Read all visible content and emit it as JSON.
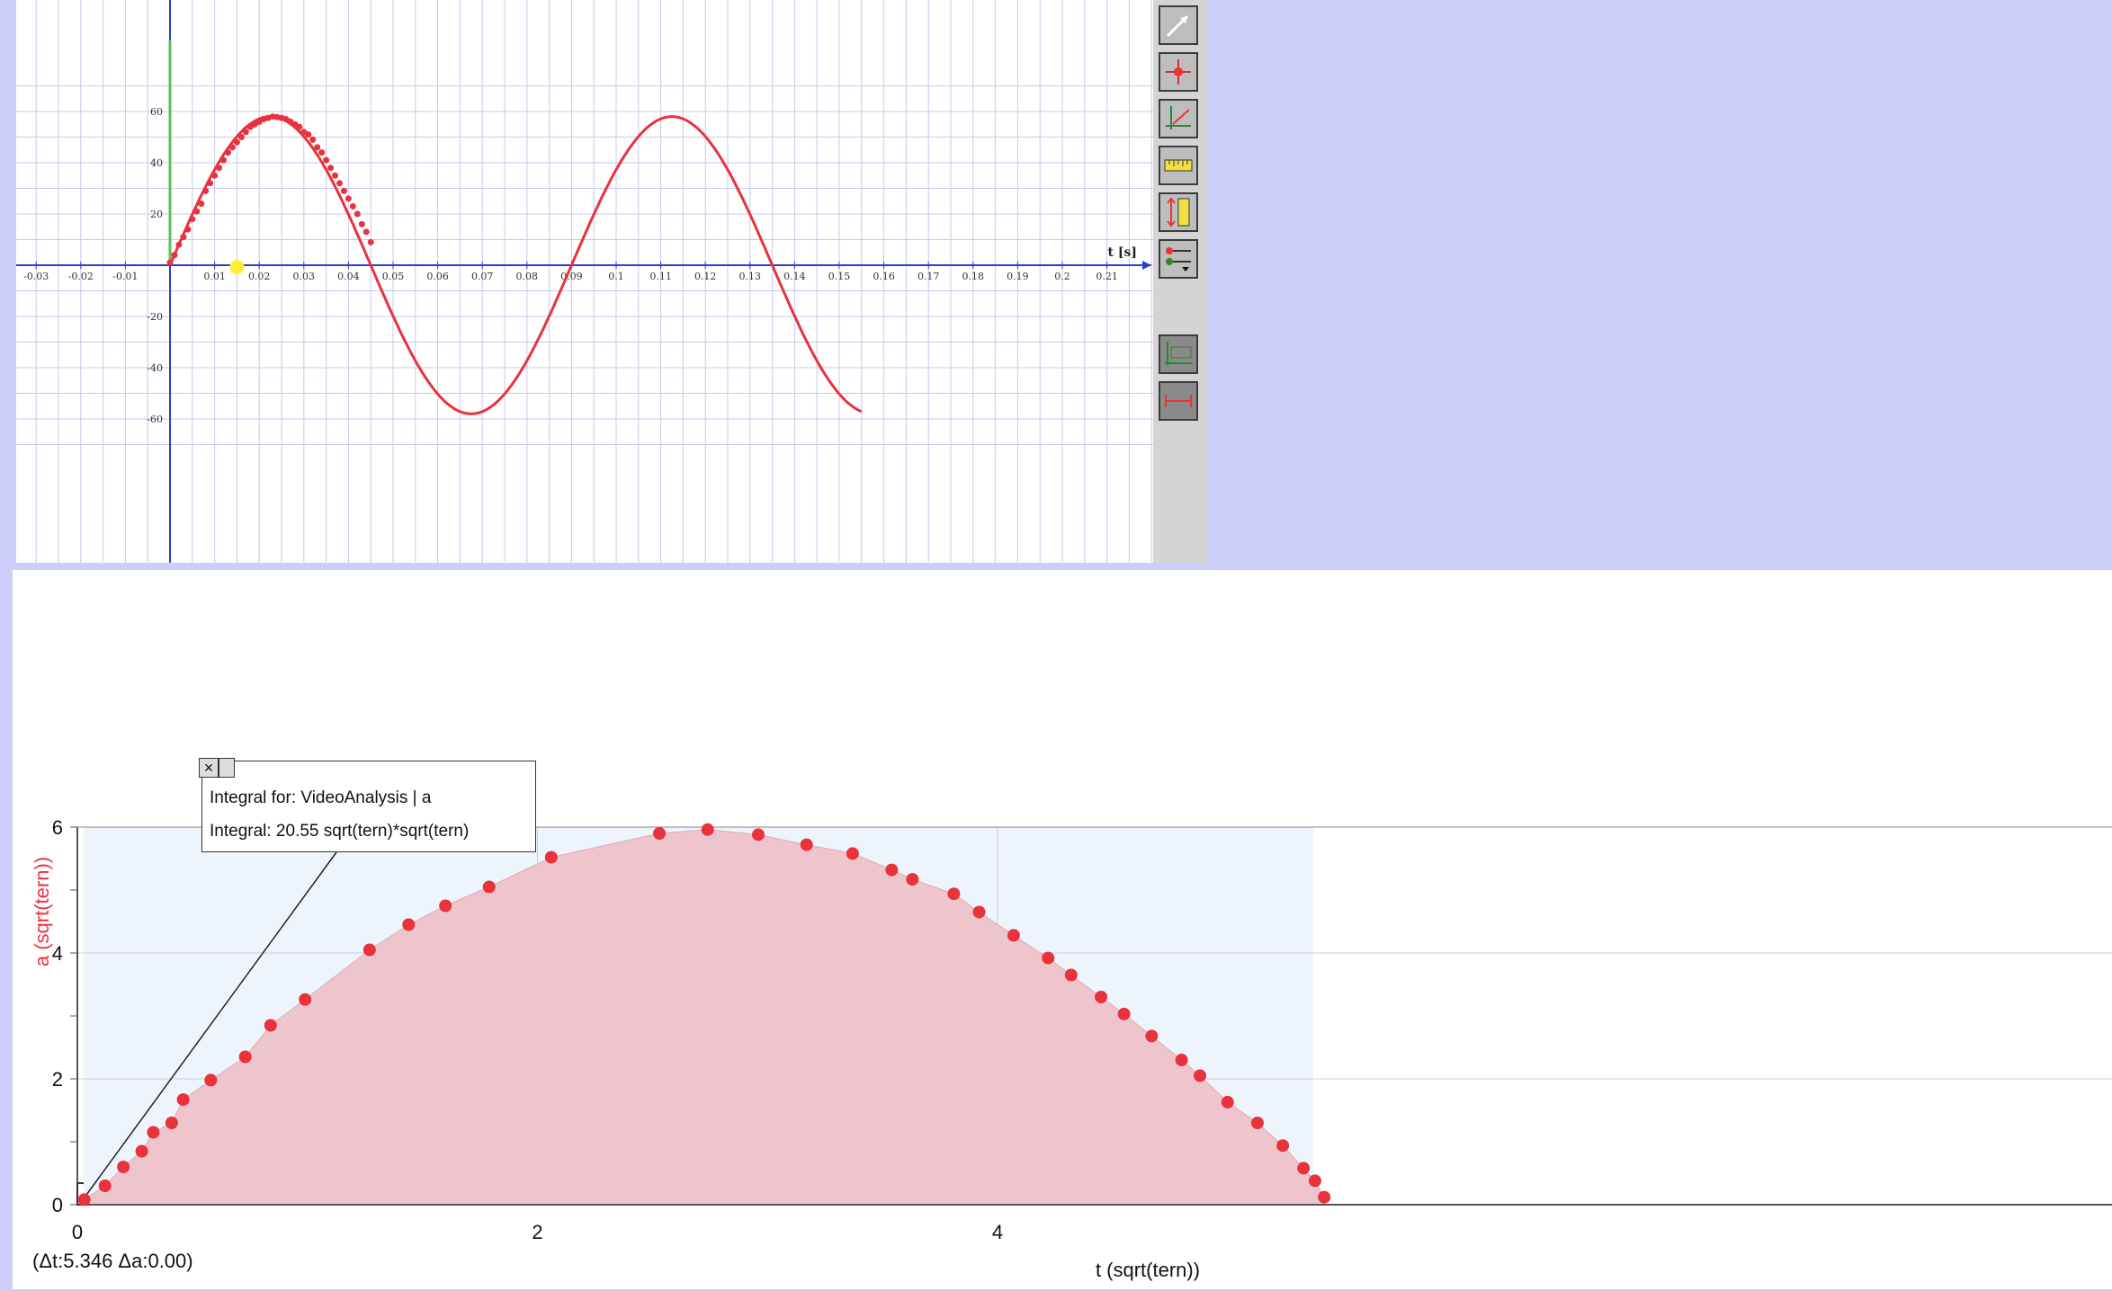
{
  "colors": {
    "background": "#cccdf8",
    "curve": "#e8323c",
    "top_grid": "#c8c8f0",
    "top_axis": "#2a3fd0",
    "y_marker": "#55c455",
    "time_marker": "#ffee33",
    "fill": "#eec5cd",
    "plot_bg": "#eef4fc"
  },
  "toolbar": {
    "tools": [
      {
        "icon": "arrow-pointer-icon"
      },
      {
        "icon": "add-point-icon"
      },
      {
        "icon": "coordinate-system-icon"
      },
      {
        "icon": "ruler-icon"
      },
      {
        "icon": "vertical-ruler-icon"
      },
      {
        "icon": "series-selector-icon"
      },
      {
        "icon": "origin-reset-icon"
      },
      {
        "icon": "scale-reset-icon"
      }
    ]
  },
  "top_chart": {
    "x_unit_label": "t [s]",
    "marker_t": 0.015
  },
  "integral_box": {
    "line1": "Integral for: VideoAnalysis | a",
    "line2": "Integral: 20.55 sqrt(tern)*sqrt(tern)"
  },
  "readout": "(Δt:5.346 Δa:0.00)",
  "chart_data": [
    {
      "type": "line",
      "xlabel": "t [s]",
      "ylabel": "",
      "xlim": [
        -0.03,
        0.22
      ],
      "ylim": [
        -70,
        65
      ],
      "x_ticks": [
        -0.03,
        -0.02,
        -0.01,
        0.01,
        0.02,
        0.03,
        0.04,
        0.05,
        0.06,
        0.07,
        0.08,
        0.09,
        0.1,
        0.11,
        0.12,
        0.13,
        0.14,
        0.15,
        0.16,
        0.17,
        0.18,
        0.19,
        0.2,
        0.21
      ],
      "x_tick_labels": [
        "-0.03",
        "-0.02",
        "-0.01",
        "0.01",
        "0.02",
        "0.03",
        "0.04",
        "0.05",
        "0.06",
        "0.07",
        "0.08",
        "0.09",
        "0.1",
        "0.11",
        "0.12",
        "0.13",
        "0.14",
        "0.15",
        "0.16",
        "0.17",
        "0.18",
        "0.19",
        "0.2",
        "0.21"
      ],
      "y_ticks": [
        60,
        40,
        20,
        -20,
        -40,
        -60
      ],
      "y_tick_labels": [
        "60",
        "40",
        "20",
        "-20",
        "-40",
        "-60"
      ],
      "grid": true,
      "curve": {
        "type": "sine",
        "amplitude": 58,
        "period": 0.09,
        "t_start": 0,
        "t_end": 0.155
      },
      "points": [
        [
          0.0,
          1
        ],
        [
          0.001,
          4
        ],
        [
          0.002,
          8
        ],
        [
          0.003,
          11
        ],
        [
          0.004,
          14
        ],
        [
          0.005,
          18
        ],
        [
          0.006,
          21
        ],
        [
          0.007,
          24
        ],
        [
          0.008,
          29
        ],
        [
          0.009,
          32
        ],
        [
          0.01,
          35
        ],
        [
          0.011,
          38
        ],
        [
          0.012,
          41
        ],
        [
          0.013,
          44
        ],
        [
          0.014,
          46
        ],
        [
          0.015,
          48
        ],
        [
          0.016,
          50
        ],
        [
          0.017,
          52
        ],
        [
          0.018,
          54
        ],
        [
          0.019,
          55
        ],
        [
          0.02,
          56
        ],
        [
          0.021,
          57
        ],
        [
          0.022,
          57.5
        ],
        [
          0.023,
          58
        ],
        [
          0.024,
          57.8
        ],
        [
          0.025,
          57.5
        ],
        [
          0.026,
          57
        ],
        [
          0.027,
          56
        ],
        [
          0.028,
          55
        ],
        [
          0.029,
          54
        ],
        [
          0.03,
          52
        ],
        [
          0.031,
          51
        ],
        [
          0.032,
          49
        ],
        [
          0.033,
          46
        ],
        [
          0.034,
          44
        ],
        [
          0.035,
          41
        ],
        [
          0.036,
          38
        ],
        [
          0.037,
          35
        ],
        [
          0.038,
          32
        ],
        [
          0.039,
          29
        ],
        [
          0.04,
          26
        ],
        [
          0.041,
          23
        ],
        [
          0.042,
          20
        ],
        [
          0.043,
          16
        ],
        [
          0.044,
          13
        ],
        [
          0.045,
          9
        ]
      ]
    },
    {
      "type": "area",
      "xlabel": "t (sqrt(tern))",
      "ylabel": "a (sqrt(tern))",
      "xlim": [
        0,
        5.8
      ],
      "ylim": [
        0,
        6
      ],
      "x_ticks": [
        0,
        2,
        4
      ],
      "y_ticks": [
        0,
        2,
        4,
        6
      ],
      "grid": true,
      "integration_range": [
        0.03,
        5.376
      ],
      "x": [
        0.03,
        0.12,
        0.2,
        0.28,
        0.33,
        0.41,
        0.46,
        0.58,
        0.73,
        0.84,
        0.99,
        1.27,
        1.44,
        1.6,
        1.79,
        2.06,
        2.53,
        2.74,
        2.96,
        3.17,
        3.37,
        3.54,
        3.63,
        3.81,
        3.92,
        4.07,
        4.22,
        4.32,
        4.45,
        4.55,
        4.67,
        4.8,
        4.88,
        5.0,
        5.13,
        5.24,
        5.33,
        5.38,
        5.42
      ],
      "y": [
        0.08,
        0.3,
        0.6,
        0.85,
        1.15,
        1.3,
        1.67,
        1.98,
        2.35,
        2.85,
        3.26,
        4.05,
        4.45,
        4.75,
        5.05,
        5.52,
        5.9,
        5.96,
        5.88,
        5.72,
        5.58,
        5.32,
        5.17,
        4.94,
        4.65,
        4.28,
        3.92,
        3.65,
        3.3,
        3.03,
        2.68,
        2.3,
        2.05,
        1.63,
        1.3,
        0.94,
        0.58,
        0.38,
        0.12
      ]
    }
  ]
}
